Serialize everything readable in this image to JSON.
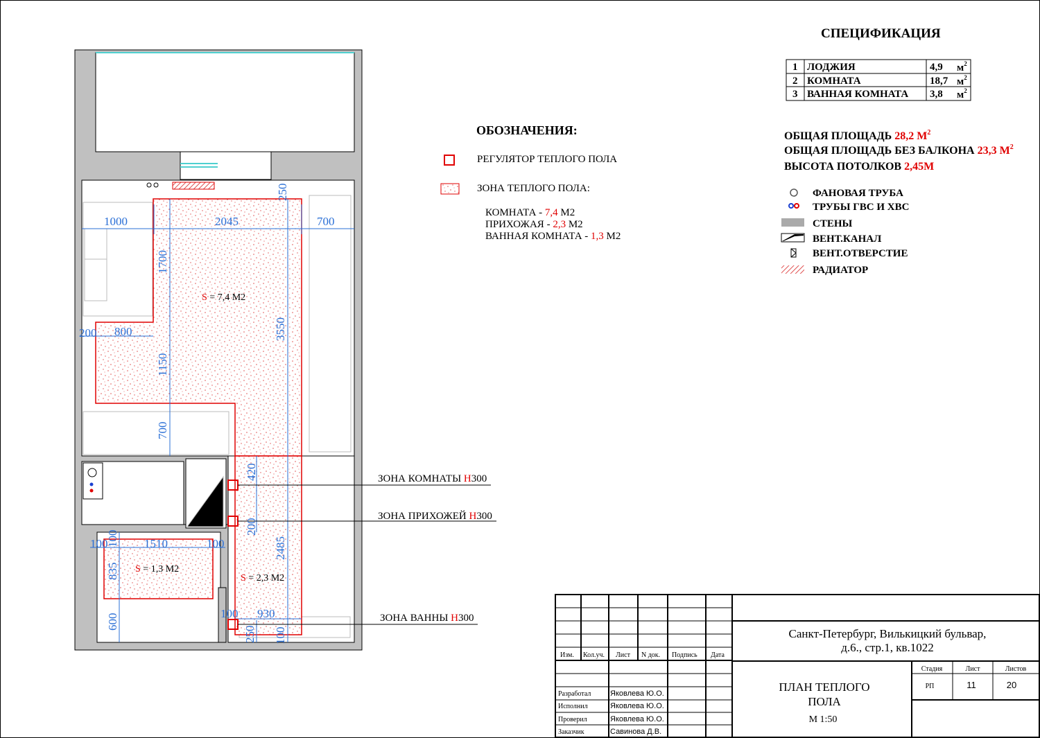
{
  "spec": {
    "title": "СПЕЦИФИКАЦИЯ",
    "rows": [
      {
        "num": "1",
        "name": "ЛОДЖИЯ",
        "area": "4,9",
        "unit": "м"
      },
      {
        "num": "2",
        "name": "КОМНАТА",
        "area": "18,7",
        "unit": "м"
      },
      {
        "num": "3",
        "name": "ВАННАЯ КОМНАТА",
        "area": "3,8",
        "unit": "м"
      }
    ],
    "unit_power": "2"
  },
  "totals": {
    "area_label": "ОБЩАЯ ПЛОЩАДЬ",
    "area_value": "28,2 М",
    "area_nobalcony_label": "ОБЩАЯ ПЛОЩАДЬ БЕЗ БАЛКОНА",
    "area_nobalcony_value": "23,3 М",
    "power": "2",
    "height_label": "ВЫСОТА ПОТОЛКОВ",
    "height_value": "2,45М"
  },
  "legend_pipes": [
    {
      "icon": "fan-pipe-icon",
      "label": "ФАНОВАЯ ТРУБА"
    },
    {
      "icon": "hot-cold-pipes-icon",
      "label": "ТРУБЫ ГВС И ХВС"
    },
    {
      "icon": "wall-swatch-icon",
      "label": "СТЕНЫ"
    },
    {
      "icon": "vent-channel-icon",
      "label": "ВЕНТ.КАНАЛ"
    },
    {
      "icon": "vent-hole-icon",
      "label": "ВЕНТ.ОТВЕРСТИЕ"
    },
    {
      "icon": "radiator-swatch-icon",
      "label": "РАДИАТОР"
    }
  ],
  "designations": {
    "title": "ОБОЗНАЧЕНИЯ:",
    "regulator": "РЕГУЛЯТОР ТЕПЛОГО ПОЛА",
    "zone": "ЗОНА ТЕПЛОГО ПОЛА:",
    "zones": [
      {
        "name": "КОМНАТА - ",
        "value": "7,4",
        "unit": " М2"
      },
      {
        "name": "ПРИХОЖАЯ - ",
        "value": "2,3",
        "unit": " М2"
      },
      {
        "name": "ВАННАЯ КОМНАТА - ",
        "value": "1,3",
        "unit": " М2"
      }
    ]
  },
  "plan": {
    "area_room": {
      "s": "S",
      "rest": " = 7,4 М2"
    },
    "area_hall": {
      "s": "S",
      "rest": " = 2,3 М2"
    },
    "area_bath": {
      "s": "S",
      "rest": " = 1,3 М2"
    },
    "dims": {
      "d1000": "1000",
      "d2045": "2045",
      "d700a": "700",
      "d250a": "250",
      "d1700": "1700",
      "d3550": "3550",
      "d200a": "200",
      "d800": "800",
      "d1150": "1150",
      "d700b": "700",
      "d420": "420",
      "d200b": "200",
      "d2485": "2485",
      "d100a": "100",
      "d100b": "100",
      "d1510": "1510",
      "d100c": "100",
      "d835": "835",
      "d600": "600",
      "d100d": "100",
      "d930": "930",
      "d250b": "250",
      "d100e": "100"
    },
    "callouts": [
      {
        "text": "ЗОНА КОМНАТЫ ",
        "h": "Н",
        "val": "300"
      },
      {
        "text": "ЗОНА ПРИХОЖЕЙ ",
        "h": "Н",
        "val": "300"
      },
      {
        "text": "ЗОНА ВАННЫ ",
        "h": "Н",
        "val": "300"
      }
    ]
  },
  "stamp": {
    "headers": [
      "Изм.",
      "Кол.уч.",
      "Лист",
      "N док.",
      "Подпись",
      "Дата"
    ],
    "roles": [
      {
        "role": "Разработал",
        "name": "Яковлева Ю.О."
      },
      {
        "role": "Исполнил",
        "name": "Яковлева Ю.О."
      },
      {
        "role": "Проверил",
        "name": "Яковлева Ю.О."
      },
      {
        "role": "Заказчик",
        "name": "Савинова Д.В."
      }
    ],
    "address_line1": "Санкт-Петербург, Вилькицкий бульвар,",
    "address_line2": "д.6., стр.1, кв.1022",
    "title_line1": "ПЛАН ТЕПЛОГО",
    "title_line2": "ПОЛА",
    "scale": "М 1:50",
    "stage_label": "Стадия",
    "sheet_label": "Лист",
    "sheets_label": "Листов",
    "stage": "РП",
    "sheet": "11",
    "sheets": "20"
  },
  "colors": {
    "accent": "#e00000",
    "dim": "#2a6fd6",
    "wall": "#c0c0c0"
  }
}
